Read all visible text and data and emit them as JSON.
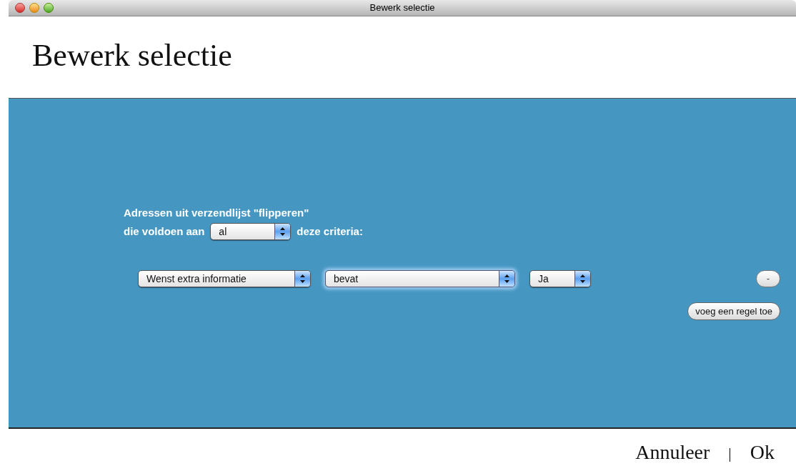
{
  "window": {
    "title": "Bewerk selectie"
  },
  "heading": "Bewerk selectie",
  "intro": {
    "line_1": "Adressen uit verzendlijst \"flipperen\"",
    "prefix": "die voldoen aan",
    "match": {
      "value": "al",
      "focused": false
    },
    "suffix": "deze criteria:"
  },
  "rule": {
    "fields": [
      {
        "value": "Wenst extra informatie",
        "focused": false
      },
      {
        "value": "bevat",
        "focused": true
      },
      {
        "value": "Ja",
        "focused": false
      }
    ],
    "remove_button": "-"
  },
  "add_button": "voeg een regel toe",
  "footer": {
    "cancel": "Annuleer",
    "separator": "|",
    "ok": "Ok"
  }
}
